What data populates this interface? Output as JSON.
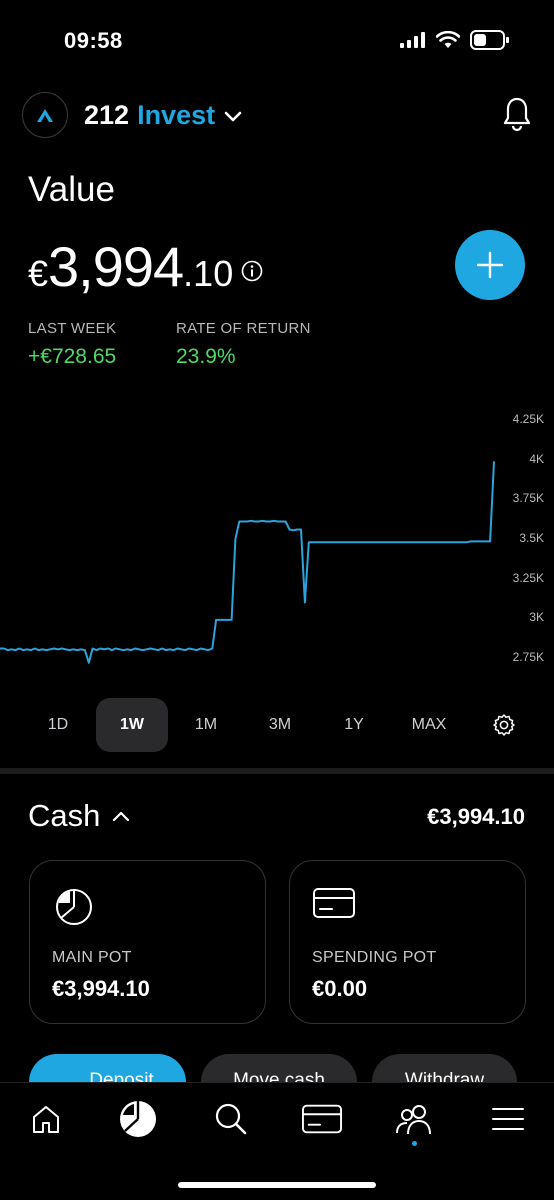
{
  "status_bar": {
    "time": "09:58"
  },
  "header": {
    "app_name_number": "212",
    "app_name_word": "Invest"
  },
  "value": {
    "label": "Value",
    "currency": "€",
    "main": "3,994",
    "decimals": ".10"
  },
  "stats": [
    {
      "label": "LAST WEEK",
      "value": "+€728.65"
    },
    {
      "label": "RATE OF RETURN",
      "value": "23.9%"
    }
  ],
  "chart_data": {
    "type": "line",
    "ylim": [
      2750,
      4250
    ],
    "yticks": [
      "4.25K",
      "4K",
      "3.75K",
      "3.5K",
      "3.25K",
      "3K",
      "2.75K"
    ],
    "series": [
      {
        "values": [
          2810,
          2810,
          2800,
          2805,
          2800,
          2810,
          2800,
          2805,
          2800,
          2810,
          2800,
          2805,
          2800,
          2805,
          2810,
          2805,
          2810,
          2805,
          2800,
          2805,
          2800,
          2805,
          2800,
          2720,
          2810,
          2800,
          2810,
          2805,
          2810,
          2800,
          2810,
          2805,
          2800,
          2805,
          2800,
          2810,
          2805,
          2800,
          2805,
          2810,
          2805,
          2800,
          2810,
          2800,
          2805,
          2800,
          2810,
          2805,
          2800,
          2810,
          2805,
          2800,
          2810,
          2805,
          2800,
          2810,
          2990,
          2990,
          2990,
          2990,
          2990,
          3500,
          3610,
          3610,
          3610,
          3615,
          3610,
          3610,
          3615,
          3610,
          3610,
          3615,
          3610,
          3610,
          3610,
          3560,
          3555,
          3560,
          3560,
          3100,
          3480,
          3480,
          3480,
          3480,
          3480,
          3480,
          3480,
          3480,
          3480,
          3480,
          3480,
          3480,
          3480,
          3480,
          3480,
          3480,
          3480,
          3480,
          3480,
          3480,
          3480,
          3480,
          3480,
          3480,
          3480,
          3480,
          3480,
          3480,
          3480,
          3480,
          3480,
          3480,
          3480,
          3480,
          3480,
          3480,
          3480,
          3480,
          3480,
          3480,
          3480,
          3480,
          3485,
          3485,
          3485,
          3485,
          3485,
          3485,
          3990
        ]
      }
    ],
    "line_color": "#2aa4db"
  },
  "ranges": {
    "items": [
      "1D",
      "1W",
      "1M",
      "3M",
      "1Y",
      "MAX"
    ],
    "active": "1W"
  },
  "cash": {
    "title": "Cash",
    "total": "€3,994.10",
    "pots": [
      {
        "label": "MAIN POT",
        "value": "€3,994.10"
      },
      {
        "label": "SPENDING POT",
        "value": "€0.00"
      }
    ]
  },
  "actions": [
    "Deposit",
    "Move cash",
    "Withdraw"
  ],
  "colors": {
    "accent": "#1ea7e1",
    "positive": "#4cd964",
    "background": "#000000"
  },
  "tab_bar": {
    "icons": [
      "home-icon",
      "portfolio-pie-icon",
      "search-icon",
      "card-icon",
      "community-icon",
      "menu-icon"
    ],
    "active": "portfolio-pie-icon"
  }
}
